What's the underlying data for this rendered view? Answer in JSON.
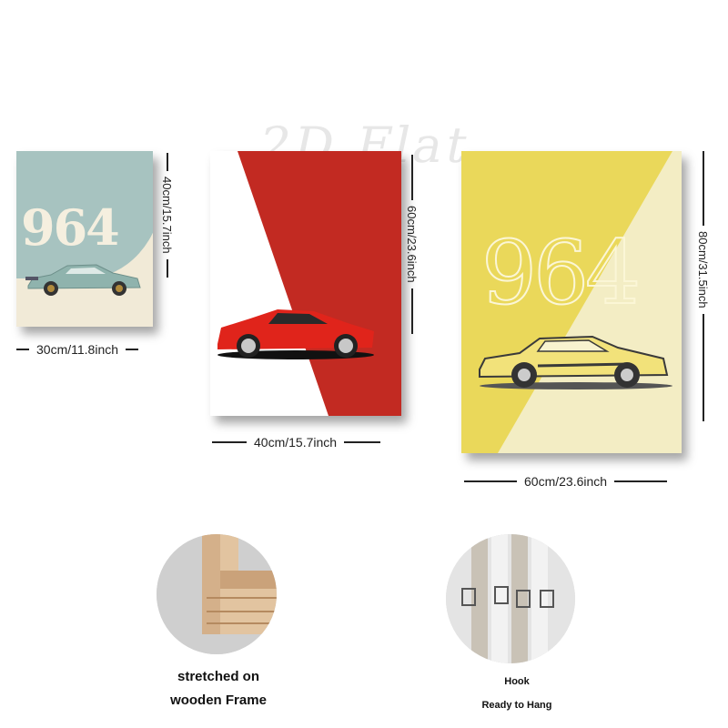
{
  "watermark": "2D Flat",
  "posters": [
    {
      "title_text": "964",
      "width_label": "30cm/11.8inch",
      "height_label": "40cm/15.7inch",
      "colors": {
        "bg": "#f1ead7",
        "circle": "#a7c3c0",
        "car": "#8fb3ad"
      }
    },
    {
      "width_label": "40cm/15.7inch",
      "height_label": "60cm/23.6inch",
      "colors": {
        "bg": "#ffffff",
        "stripe": "#c22a22",
        "car": "#e0241b"
      }
    },
    {
      "title_text": "964",
      "width_label": "60cm/23.6inch",
      "height_label": "80cm/31.5inch",
      "colors": {
        "bg": "#f3edc4",
        "yellow": "#ead85a",
        "car": "#f2e27a"
      }
    }
  ],
  "features": [
    {
      "caption_line1": "stretched on",
      "caption_line2": "wooden Frame",
      "icon": "wooden-frame-corner"
    },
    {
      "caption_line1": "Hook",
      "caption_line2": "Ready to Hang",
      "icon": "hanging-hook"
    }
  ]
}
